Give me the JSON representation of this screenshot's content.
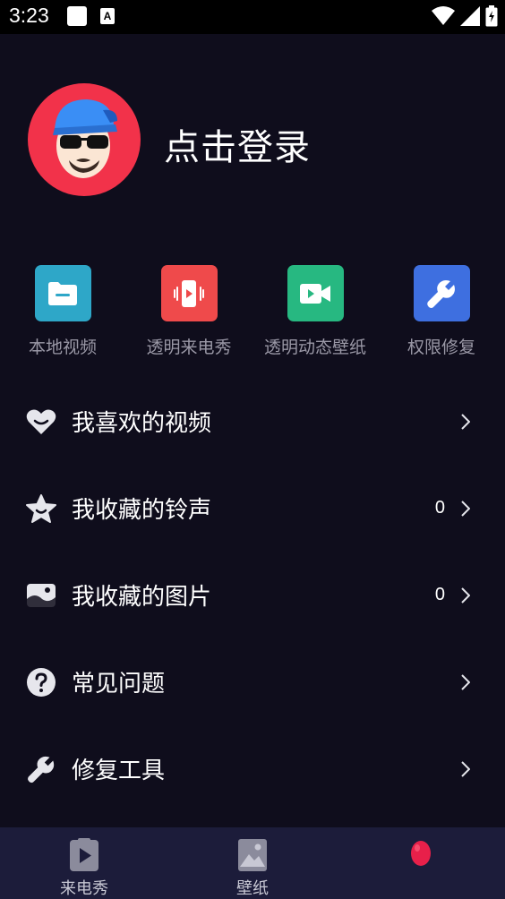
{
  "status_bar": {
    "time": "3:23",
    "a_badge": "A"
  },
  "profile": {
    "login_text": "点击登录"
  },
  "shortcuts": [
    {
      "label": "本地视频",
      "icon": "folder-icon",
      "color": "#2ea7c8"
    },
    {
      "label": "透明来电秀",
      "icon": "phone-vibrate-icon",
      "color": "#ef4a4b"
    },
    {
      "label": "透明动态壁纸",
      "icon": "video-camera-icon",
      "color": "#27b881"
    },
    {
      "label": "权限修复",
      "icon": "wrench-icon",
      "color": "#3e6fe0"
    }
  ],
  "menu": [
    {
      "label": "我喜欢的视频",
      "icon": "heart-icon",
      "count": ""
    },
    {
      "label": "我收藏的铃声",
      "icon": "star-icon",
      "count": "0"
    },
    {
      "label": "我收藏的图片",
      "icon": "image-icon",
      "count": "0"
    },
    {
      "label": "常见问题",
      "icon": "question-icon",
      "count": ""
    },
    {
      "label": "修复工具",
      "icon": "wrench-icon",
      "count": ""
    }
  ],
  "tabs": [
    {
      "label": "来电秀",
      "icon": "phone-play-icon"
    },
    {
      "label": "壁纸",
      "icon": "picture-icon"
    },
    {
      "label": "",
      "icon": "profile-blob-icon"
    }
  ],
  "colors": {
    "background": "#0f0d1c",
    "tab_bar": "#1c1c3a",
    "avatar_bg": "#f2324a",
    "accent_red": "#e8204a"
  }
}
